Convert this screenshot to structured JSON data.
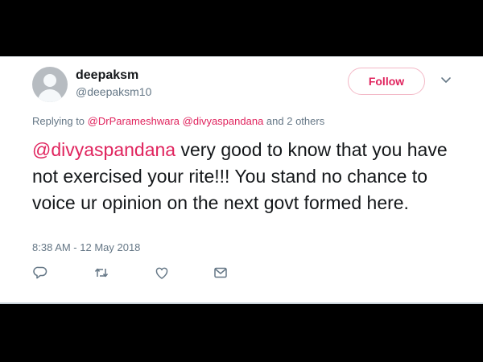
{
  "user": {
    "display_name": "deepaksm",
    "handle": "@deepaksm10"
  },
  "follow_button": {
    "label": "Follow"
  },
  "replying": {
    "prefix": "Replying to",
    "mention_1": "@DrParameshwara",
    "mention_2": "@divyaspandana",
    "suffix": "and 2 others"
  },
  "tweet": {
    "mention": "@divyaspandana",
    "body": "very good to know that you have not exercised your rite!!! You stand no chance to voice ur opinion on the next govt formed here."
  },
  "timestamp": "8:38 AM - 12 May 2018",
  "actions": {
    "reply_icon": "reply-icon",
    "retweet_icon": "retweet-icon",
    "like_icon": "like-icon",
    "message_icon": "message-icon"
  },
  "colors": {
    "accent": "#e0245e",
    "secondary_text": "#657786",
    "primary_text": "#14171a",
    "background": "#000000",
    "card": "#ffffff"
  }
}
